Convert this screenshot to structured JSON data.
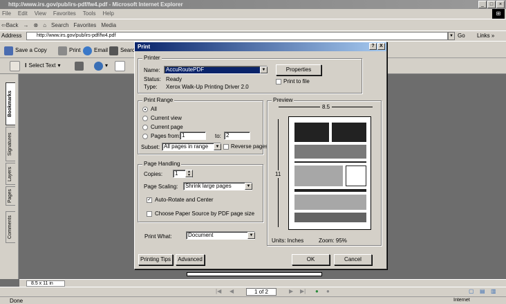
{
  "browser": {
    "title": "http://www.irs.gov/pub/irs-pdf/fw4.pdf - Microsoft Internet Explorer",
    "menu": [
      "File",
      "Edit",
      "View",
      "Favorites",
      "Tools",
      "Help"
    ],
    "toolbar": [
      "⇦Back",
      "→",
      "⊗",
      "⌂",
      "Search",
      "Favorites",
      "Media"
    ],
    "address_label": "Address",
    "address_value": "http://www.irs.gov/pub/irs-pdf/fw4.pdf",
    "go": "Go",
    "links": "Links »",
    "status": "Done",
    "zone": "Internet"
  },
  "acrobat": {
    "save_copy": "Save a Copy",
    "print": "Print",
    "email": "Email",
    "search": "Searc",
    "select_text": "Select Text",
    "tabs": [
      "Bookmarks",
      "Signatures",
      "Layers",
      "Pages",
      "Comments"
    ],
    "page_size": "8.5 x 11 in",
    "page_indicator": "1 of 2"
  },
  "dialog": {
    "title": "Print",
    "help": "?",
    "close": "X",
    "printer": {
      "group": "Printer",
      "name_label": "Name:",
      "name_value": "AccuRoutePDF",
      "status_label": "Status:",
      "status_value": "Ready",
      "type_label": "Type:",
      "type_value": "Xerox Walk-Up Printing Driver 2.0",
      "properties": "Properties",
      "print_to_file": "Print to file"
    },
    "range": {
      "group": "Print Range",
      "all": "All",
      "current_view": "Current view",
      "current_page": "Current page",
      "pages_from": "Pages from:",
      "from_value": "1",
      "to_label": "to:",
      "to_value": "2",
      "subset_label": "Subset:",
      "subset_value": "All pages in range",
      "reverse": "Reverse pages"
    },
    "handling": {
      "group": "Page Handling",
      "copies_label": "Copies:",
      "copies_value": "1",
      "scaling_label": "Page Scaling:",
      "scaling_value": "Shrink large pages",
      "auto_rotate": "Auto-Rotate and Center",
      "paper_source": "Choose Paper Source by PDF page size"
    },
    "print_what_label": "Print What:",
    "print_what_value": "Document",
    "preview": {
      "group": "Preview",
      "width": "8.5",
      "height": "11",
      "units": "Units: Inches",
      "zoom": "Zoom: 95%"
    },
    "buttons": {
      "tips": "Printing Tips",
      "advanced": "Advanced",
      "ok": "OK",
      "cancel": "Cancel"
    }
  }
}
